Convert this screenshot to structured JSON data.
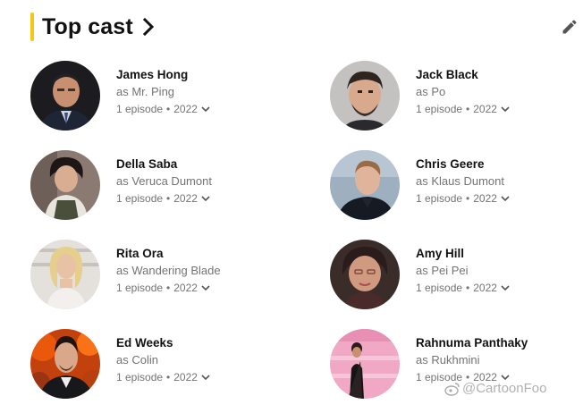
{
  "section": {
    "title": "Top cast"
  },
  "cast": [
    {
      "name": "James Hong",
      "role": "as Mr. Ping",
      "episodes": "1 episode",
      "year": "2022"
    },
    {
      "name": "Jack Black",
      "role": "as Po",
      "episodes": "1 episode",
      "year": "2022"
    },
    {
      "name": "Della Saba",
      "role": "as Veruca Dumont",
      "episodes": "1 episode",
      "year": "2022"
    },
    {
      "name": "Chris Geere",
      "role": "as Klaus Dumont",
      "episodes": "1 episode",
      "year": "2022"
    },
    {
      "name": "Rita Ora",
      "role": "as Wandering Blade",
      "episodes": "1 episode",
      "year": "2022"
    },
    {
      "name": "Amy Hill",
      "role": "as Pei Pei",
      "episodes": "1 episode",
      "year": "2022"
    },
    {
      "name": "Ed Weeks",
      "role": "as Colin",
      "episodes": "1 episode",
      "year": "2022"
    },
    {
      "name": "Rahnuma Panthaky",
      "role": "as Rukhmini",
      "episodes": "1 episode",
      "year": "2022"
    }
  ],
  "separator": "•",
  "watermark": {
    "text": "@CartoonFoo"
  },
  "icons": {
    "title_arrow": "chevron-right-icon",
    "edit": "pencil-icon",
    "expand": "chevron-down-icon"
  },
  "colors": {
    "accent": "#f5c518",
    "text": "#121212",
    "secondary": "#737373"
  }
}
